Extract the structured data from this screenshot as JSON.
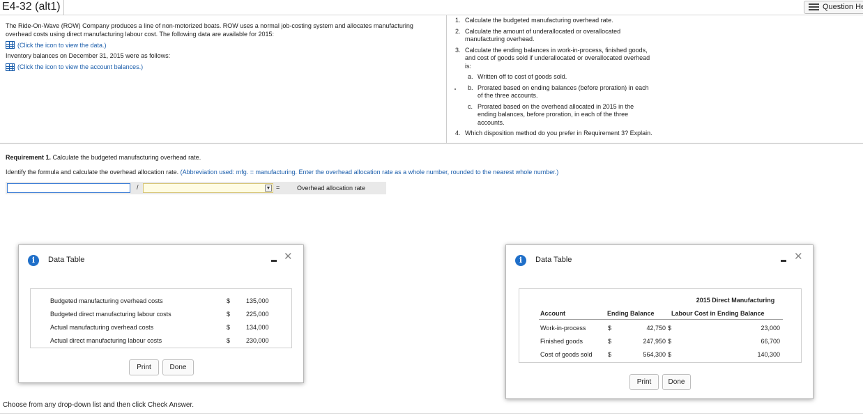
{
  "header": {
    "title": "E4-32 (alt1)",
    "question_help": "Question Help"
  },
  "problem": {
    "intro": "The Ride-On-Wave (ROW) Company produces a line of non-motorized boats. ROW uses a normal job-costing system and allocates manufacturing overhead costs using direct manufacturing labour cost. The following data are available for 2015:",
    "data_link": "(Click the icon to view the data.)",
    "inventory_text": "Inventory balances on December 31, 2015 were as follows:",
    "balances_link": "(Click the icon to view the account balances.)"
  },
  "requirements": [
    {
      "num": "1.",
      "text": "Calculate the budgeted manufacturing overhead rate."
    },
    {
      "num": "2.",
      "text": "Calculate the amount of underallocated or overallocated manufacturing overhead."
    },
    {
      "num": "3.",
      "text": "Calculate the ending balances in work-in-process, finished goods, and cost of goods sold if underallocated or overallocated overhead is:"
    },
    {
      "num": "a.",
      "text": "Written off to cost of goods sold."
    },
    {
      "num": "b.",
      "text": "Prorated based on ending balances (before proration) in each of the three accounts."
    },
    {
      "num": "c.",
      "text": "Prorated based on the overhead allocated in 2015 in the ending balances, before proration, in each of the three accounts."
    },
    {
      "num": "4.",
      "text": "Which disposition method do you prefer in Requirement 3? Explain."
    }
  ],
  "question": {
    "req_label": "Requirement 1.",
    "req_text": "Calculate the budgeted manufacturing overhead rate.",
    "instruction": "Identify the formula and calculate the overhead allocation rate.",
    "note": "(Abbreviation used: mfg. = manufacturing. Enter the overhead allocation rate as a whole number, rounded to the nearest whole number.)",
    "numerator_value": "",
    "slash": "/",
    "denominator_selected": "",
    "equals": "=",
    "result_label": "Overhead allocation rate"
  },
  "dialog1": {
    "title": "Data Table",
    "rows": [
      {
        "label": "Budgeted manufacturing overhead costs",
        "cur": "$",
        "value": "135,000"
      },
      {
        "label": "Budgeted direct manufacturing labour costs",
        "cur": "$",
        "value": "225,000"
      },
      {
        "label": "Actual manufacturing overhead costs",
        "cur": "$",
        "value": "134,000"
      },
      {
        "label": "Actual direct manufacturing labour costs",
        "cur": "$",
        "value": "230,000"
      }
    ],
    "print_label": "Print",
    "done_label": "Done"
  },
  "dialog2": {
    "title": "Data Table",
    "header_top": "2015 Direct Manufacturing",
    "col_account": "Account",
    "col_ending": "Ending Balance",
    "col_labour": "Labour Cost in Ending Balance",
    "rows": [
      {
        "account": "Work-in-process",
        "cur1": "$",
        "ending": "42,750",
        "cur2": "$",
        "labour": "23,000"
      },
      {
        "account": "Finished goods",
        "cur1": "$",
        "ending": "247,950",
        "cur2": "$",
        "labour": "66,700"
      },
      {
        "account": "Cost of goods sold",
        "cur1": "$",
        "ending": "564,300",
        "cur2": "$",
        "labour": "140,300"
      }
    ],
    "print_label": "Print",
    "done_label": "Done"
  },
  "footer": {
    "text": "Choose from any drop-down list and then click Check Answer."
  },
  "colors": {
    "link": "#1a5dab",
    "info_icon": "#1f6fc9",
    "input_border": "#3f7fd6",
    "select_bg": "#fffce3"
  }
}
